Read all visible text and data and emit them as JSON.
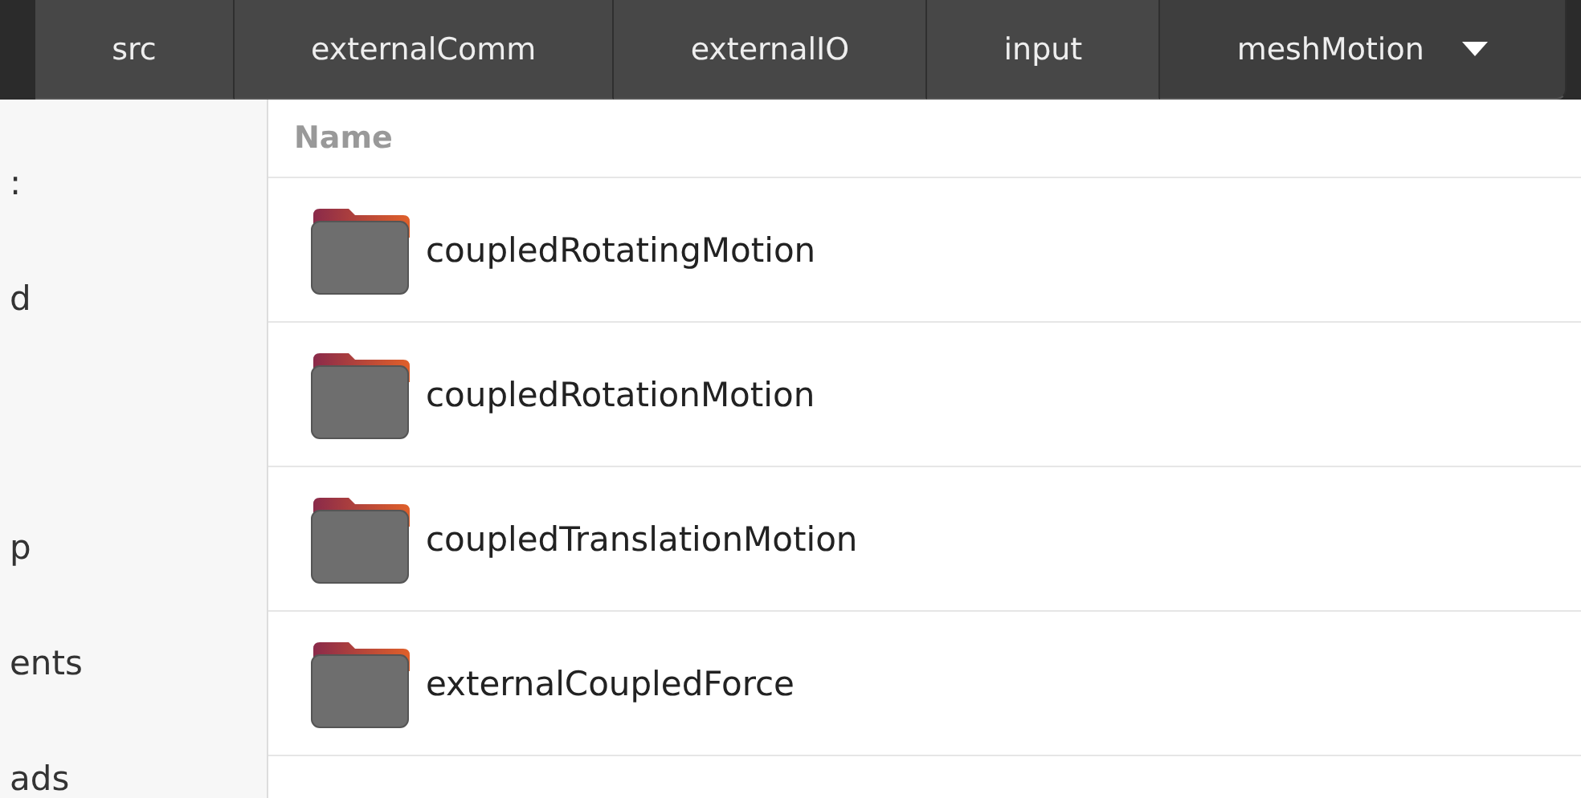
{
  "path_bar": {
    "segments": [
      {
        "label": "src",
        "selected": false
      },
      {
        "label": "externalComm",
        "selected": false
      },
      {
        "label": "externalIO",
        "selected": false
      },
      {
        "label": "input",
        "selected": false
      },
      {
        "label": "meshMotion",
        "selected": true
      }
    ]
  },
  "sidebar": {
    "items": [
      ":",
      "d",
      "p",
      "ents",
      "ads"
    ]
  },
  "file_list": {
    "columns": [
      "Name"
    ],
    "rows": [
      {
        "name": "coupledRotatingMotion",
        "kind": "folder"
      },
      {
        "name": "coupledRotationMotion",
        "kind": "folder"
      },
      {
        "name": "coupledTranslationMotion",
        "kind": "folder"
      },
      {
        "name": "externalCoupledForce",
        "kind": "folder"
      }
    ]
  }
}
